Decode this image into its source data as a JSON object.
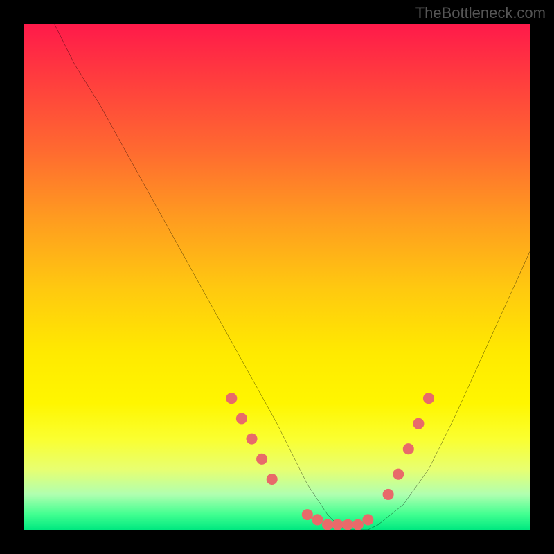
{
  "watermark": "TheBottleneck.com",
  "chart_data": {
    "type": "line",
    "title": "",
    "xlabel": "",
    "ylabel": "",
    "xlim": [
      0,
      100
    ],
    "ylim": [
      0,
      100
    ],
    "curve": {
      "name": "bottleneck-curve",
      "x": [
        6,
        10,
        15,
        20,
        25,
        30,
        35,
        40,
        45,
        50,
        52,
        54,
        56,
        58,
        60,
        62,
        64,
        66,
        68,
        70,
        75,
        80,
        85,
        90,
        95,
        100
      ],
      "y": [
        100,
        92,
        84,
        75,
        66,
        57,
        48,
        39,
        30,
        21,
        17,
        13,
        9,
        6,
        3,
        1,
        0,
        0,
        0,
        1,
        5,
        12,
        22,
        33,
        44,
        55
      ]
    },
    "marker_ranges": [
      {
        "x": [
          41,
          43,
          45,
          47,
          49
        ],
        "y": [
          26,
          22,
          18,
          14,
          10
        ]
      },
      {
        "x": [
          56,
          58,
          60,
          62,
          64,
          66,
          68
        ],
        "y": [
          3,
          2,
          1,
          1,
          1,
          1,
          2
        ]
      },
      {
        "x": [
          72,
          74,
          76,
          78,
          80
        ],
        "y": [
          7,
          11,
          16,
          21,
          26
        ]
      }
    ],
    "marker_color": "#e86a6a",
    "gradient_stops": [
      {
        "pos": 0,
        "color": "#ff1a4a"
      },
      {
        "pos": 25,
        "color": "#ff6a30"
      },
      {
        "pos": 50,
        "color": "#ffc810"
      },
      {
        "pos": 75,
        "color": "#fff600"
      },
      {
        "pos": 93,
        "color": "#b0ffb0"
      },
      {
        "pos": 100,
        "color": "#00e880"
      }
    ]
  }
}
